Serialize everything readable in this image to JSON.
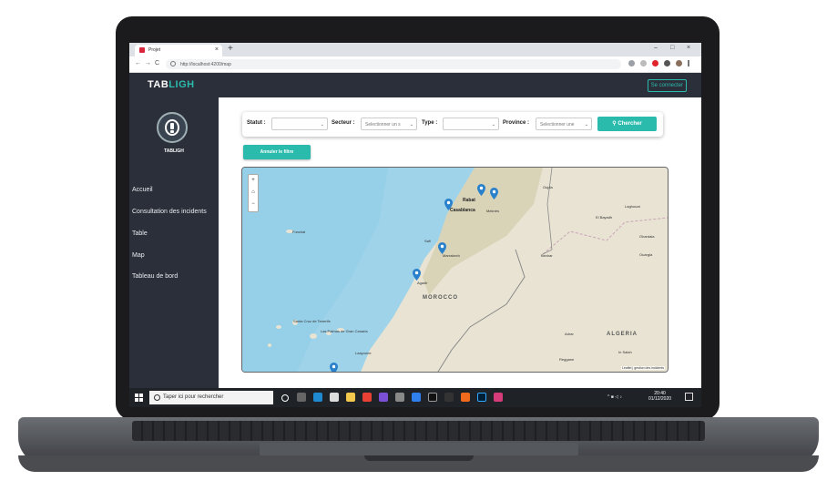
{
  "browser": {
    "tab_title": "Projet",
    "tab_close": "×",
    "new_tab": "+",
    "minimize": "–",
    "maximize": "□",
    "close": "×",
    "back": "←",
    "forward": "→",
    "reload": "C",
    "url": "http://localhost:4200/map"
  },
  "app": {
    "brand_part1": "TAB",
    "brand_part2": "LIGH",
    "login_label": "Se connecter",
    "logo_label": "TABLIGH"
  },
  "sidebar": {
    "items": [
      {
        "label": "Accueil"
      },
      {
        "label": "Consultation des incidents"
      },
      {
        "label": "Table"
      },
      {
        "label": "Map"
      },
      {
        "label": "Tableau de bord"
      }
    ]
  },
  "filters": {
    "statut_label": "Statut :",
    "statut_value": "",
    "secteur_label": "Secteur :",
    "secteur_value": "Selectionner un s",
    "type_label": "Type :",
    "type_value": "",
    "province_label": "Province :",
    "province_value": "Selectionner une",
    "search_label": "Chercher",
    "reset_label": "Annuler le filtre"
  },
  "map": {
    "zoom_in": "+",
    "home": "⌂",
    "zoom_out": "−",
    "labels": {
      "rabat": "Rabat",
      "casablanca": "Casablanca",
      "meknes": "Meknès",
      "safi": "Safi",
      "marrakech": "Marrakech",
      "agadir": "Agadir",
      "morocco": "MOROCCO",
      "algeria": "ALGERIA",
      "funchal": "Funchal",
      "santa_cruz": "Santa Cruz de Tenerife",
      "las_palmas": "Las Palmas de Gran Canaria",
      "laayoune": "Laayoune",
      "bechar": "Bechar",
      "oujda": "Oujda",
      "laghouat": "Laghouat",
      "ghardaia": "Ghardaia",
      "adrar": "Adrar",
      "el_bayadh": "El Bayadh",
      "in_salah": "In Salah",
      "reggane": "Reggane",
      "ouargla": "Ouargla"
    },
    "attribution": "Leaflet | gestion des incidents"
  },
  "taskbar": {
    "search_placeholder": "Taper ici pour rechercher",
    "time": "20:40",
    "date": "01/12/2020"
  },
  "colors": {
    "accent": "#2bbbad",
    "dark": "#2b2f3a",
    "sea": "#9fd3ea",
    "land": "#e8e3d2",
    "pin": "#2a81cb"
  }
}
